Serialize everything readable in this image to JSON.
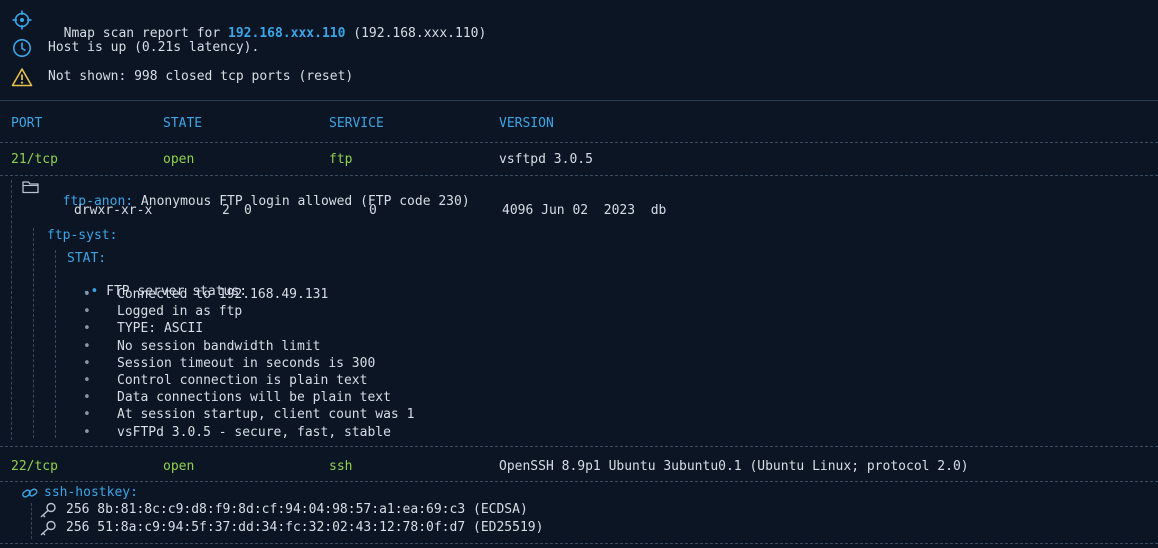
{
  "summary": {
    "scan_prefix": "Nmap scan report for ",
    "scan_host": "192.168.xxx.110",
    "scan_ip": " (192.168.xxx.110)",
    "host_status": "Host is up (0.21s latency).",
    "not_shown": "Not shown: 998 closed tcp ports (reset)"
  },
  "headers": {
    "port": "PORT",
    "state": "STATE",
    "service": "SERVICE",
    "version": "VERSION"
  },
  "ports": [
    {
      "port": "21/tcp",
      "state": "open",
      "service": "ftp",
      "version": "vsftpd 3.0.5"
    },
    {
      "port": "22/tcp",
      "state": "open",
      "service": "ssh",
      "version": "OpenSSH 8.9p1 Ubuntu 3ubuntu0.1 (Ubuntu Linux; protocol 2.0)"
    }
  ],
  "ftp_anon": {
    "name": "ftp-anon:",
    "desc": " Anonymous FTP login allowed (FTP code 230)",
    "perms": "drwxr-xr-x",
    "links": "2",
    "uid": "0",
    "gid": "0",
    "listing": "4096 Jun 02  2023  db"
  },
  "ftp_syst": {
    "name": "ftp-syst:",
    "stat": "STAT:",
    "status_title": "FTP server status:",
    "lines": [
      "Connected to 192.168.49.131",
      "Logged in as ftp",
      "TYPE: ASCII",
      "No session bandwidth limit",
      "Session timeout in seconds is 300",
      "Control connection is plain text",
      "Data connections will be plain text",
      "At session startup, client count was 1",
      "vsFTPd 3.0.5 - secure, fast, stable"
    ]
  },
  "ssh_hostkey": {
    "name": "ssh-hostkey:",
    "keys": [
      "256 8b:81:8c:c9:d8:f9:8d:cf:94:04:98:57:a1:ea:69:c3 (ECDSA)",
      "256 51:8a:c9:94:5f:37:dd:34:fc:32:02:43:12:78:0f:d7 (ED25519)"
    ]
  },
  "colors": {
    "background": "#0b1523",
    "accent": "#3aa6e8",
    "open": "#8fd14f",
    "warning": "#e8c14a"
  },
  "icons": [
    "crosshair-icon",
    "clock-icon",
    "warning-icon",
    "folder-icon",
    "link-icon",
    "key-icon"
  ]
}
